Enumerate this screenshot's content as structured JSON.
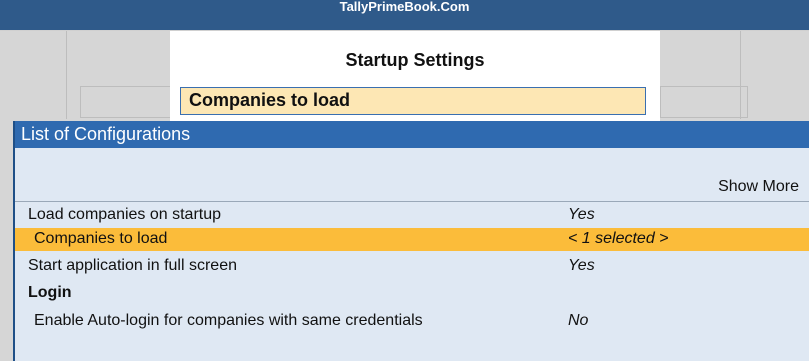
{
  "window": {
    "title": "TallyPrimeBook.Com"
  },
  "startup_settings": {
    "title": "Startup Settings",
    "active_field": "Companies to load"
  },
  "configurations": {
    "header": "List of Configurations",
    "show_more_label": "Show More",
    "rows": [
      {
        "label": "Load companies on startup",
        "value": "Yes"
      },
      {
        "label": "Companies to load",
        "value": "< 1 selected >"
      },
      {
        "label": "Start application in full screen",
        "value": "Yes"
      }
    ],
    "login_group": {
      "heading": "Login",
      "rows": [
        {
          "label": "Enable Auto-login for companies with same credentials",
          "value": "No"
        }
      ]
    }
  },
  "colors": {
    "title_bar": "#2f5a8a",
    "config_header": "#2f6ab0",
    "config_background": "#dfe8f3",
    "selected_row": "#fbbc3a",
    "field_highlight": "#fde7b4"
  }
}
